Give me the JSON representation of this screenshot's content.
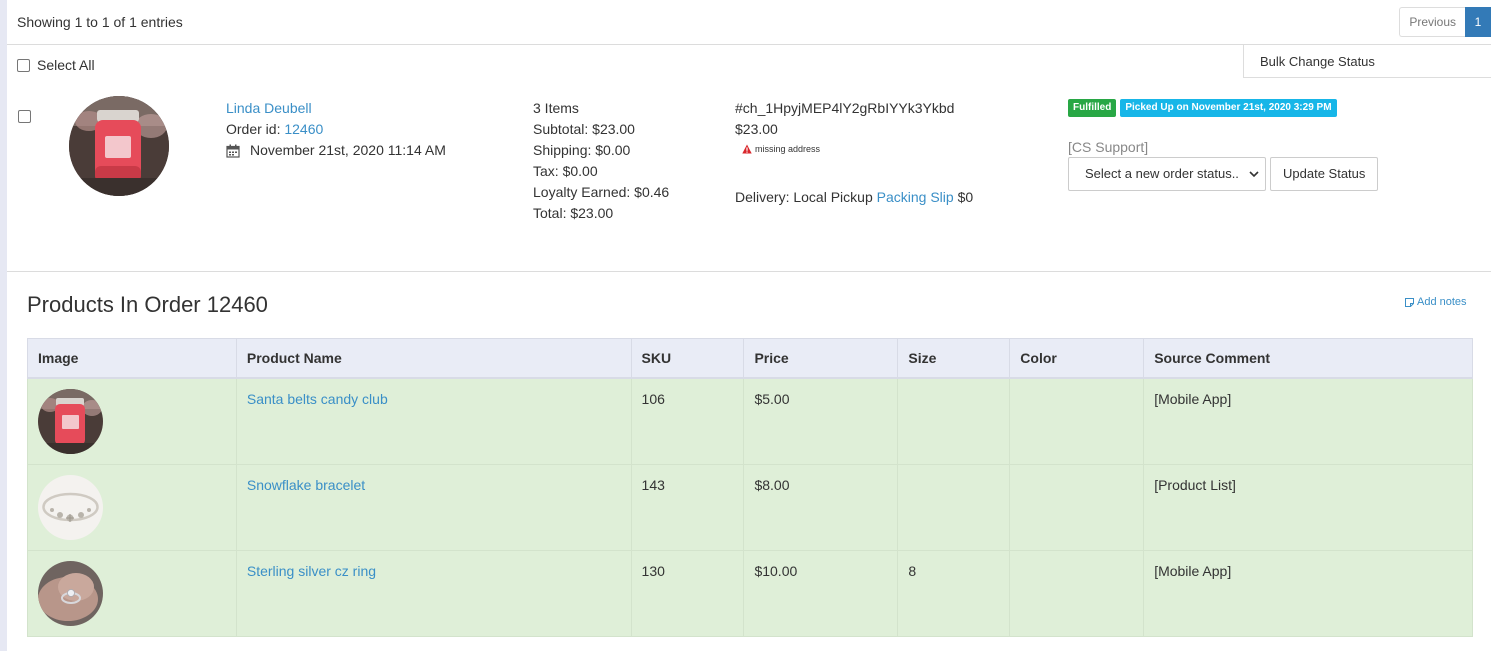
{
  "pagination": {
    "showing": "Showing 1 to 1 of 1 entries",
    "previous_label": "Previous",
    "current_page": "1"
  },
  "bulk": {
    "select_all_label": "Select All",
    "bulk_change_label": "Bulk Change Status"
  },
  "order": {
    "customer_name": "Linda Deubell",
    "order_id_label": "Order id:",
    "order_id": "12460",
    "date": "November 21st, 2020 11:14 AM",
    "items": "3 Items",
    "subtotal": "Subtotal: $23.00",
    "shipping": "Shipping: $0.00",
    "tax": "Tax: $0.00",
    "loyalty": "Loyalty Earned: $0.46",
    "total": "Total: $23.00",
    "charge_id": "#ch_1HpyjMEP4lY2gRbIYYk3Ykbd",
    "charge_amount": "$23.00",
    "missing_address": "missing address",
    "delivery_label": "Delivery: Local Pickup",
    "packing_slip": "Packing Slip",
    "delivery_fee": "$0",
    "status_badge": "Fulfilled",
    "pickup_badge": "Picked Up on November 21st, 2020 3:29 PM",
    "cs_support": "[CS Support]",
    "status_select_placeholder": "Select a new order status..",
    "update_status_label": "Update Status"
  },
  "products": {
    "title": "Products In Order 12460",
    "add_notes": "Add notes",
    "headers": [
      "Image",
      "Product Name",
      "SKU",
      "Price",
      "Size",
      "Color",
      "Source Comment"
    ],
    "rows": [
      {
        "name": "Santa belts candy club",
        "sku": "106",
        "price": "$5.00",
        "size": "",
        "color": "",
        "source": "[Mobile App]",
        "image": "candy-jar"
      },
      {
        "name": "Snowflake bracelet",
        "sku": "143",
        "price": "$8.00",
        "size": "",
        "color": "",
        "source": "[Product List]",
        "image": "bracelet"
      },
      {
        "name": "Sterling silver cz ring",
        "sku": "130",
        "price": "$10.00",
        "size": "8",
        "color": "",
        "source": "[Mobile App]",
        "image": "ring"
      }
    ]
  },
  "colors": {
    "link": "#3a8fc7",
    "fulfilled": "#28a745",
    "picked_up": "#17b6e8",
    "row_bg": "#dfefd8",
    "page_active": "#337ab7"
  }
}
